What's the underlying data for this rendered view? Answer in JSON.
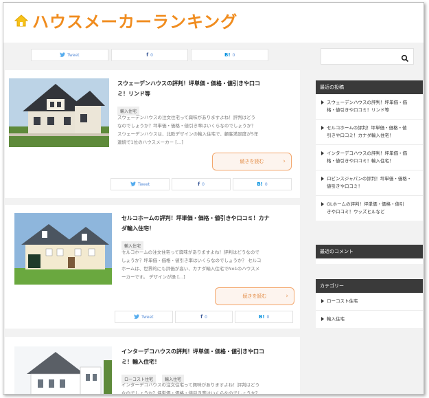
{
  "site": {
    "title": "ハウスメーカーランキング"
  },
  "share": {
    "tweet": "Tweet",
    "fb_count": "0",
    "hb_count": "0",
    "fb_icon": "f",
    "hb_icon": "B!"
  },
  "articles": [
    {
      "title_line1": "スウェーデンハウスの評判！坪単価・価格・値引きや口コ",
      "title_line2": "ミ！リンド等",
      "tags": [
        "輸入住宅"
      ],
      "excerpt": [
        "スウェーデンハウスの注文住宅って興味がありますよね！評判はどう",
        "なのでしょうか？坪単価・価格・値引き率はいくらなのでしょうか？",
        "スウェーデンハウスは、北欧デザインの輸入住宅で、顧客満足度が5年",
        "連続で1位のハウスメーカー […]"
      ],
      "more": "続きを読む"
    },
    {
      "title_line1": "セルコホームの評判！坪単価・価格・値引きや口コミ！カナ",
      "title_line2": "ダ輸入住宅！",
      "tags": [
        "輸入住宅"
      ],
      "excerpt": [
        "セルコホームの注文住宅って興味がありますよね！評判はどうなので",
        "しょうか？坪単価・価格・値引き率はいくらなのでしょうか？ セルコ",
        "ホームは、世界的にも評価が高い、カナダ輸入住宅でNo1のハウスメ",
        "ーカーです。 デザインが操 […]"
      ],
      "more": "続きを読む"
    },
    {
      "title_line1": "インターデコハウスの評判！坪単価・価格・値引きや口コ",
      "title_line2": "ミ！輸入住宅！",
      "tags": [
        "ローコスト住宅",
        "輸入住宅"
      ],
      "excerpt": [
        "インターデコハウスの注文住宅って興味がありますよね！評判はどう",
        "なのでしょうか？坪単価・価格・値引き率はいくらなのでしょうか？"
      ]
    }
  ],
  "sidebar": {
    "recent_posts": {
      "heading": "最近の投稿",
      "items": [
        [
          "スウェーデンハウスの評判！坪単価・価",
          "格・値引きや口コミ！リンド等"
        ],
        [
          "セルコホームの評判！坪単価・価格・値",
          "引きや口コミ！カナダ輸入住宅！"
        ],
        [
          "インターデコハウスの評判！坪単価・価",
          "格・値引きや口コミ！輸入住宅！"
        ],
        [
          "ロビンスジャパンの評判！坪単価・価格・",
          "値引きや口コミ！"
        ],
        [
          "GLホームの評判！坪単価・価格・値引",
          "きや口コミ！ウッズヒルなど"
        ]
      ]
    },
    "recent_comments": {
      "heading": "最近のコメント"
    },
    "categories": {
      "heading": "カテゴリー",
      "items": [
        "ローコスト住宅",
        "輸入住宅"
      ]
    }
  },
  "colors": {
    "accent": "#f08c1e",
    "twitter": "#55acee",
    "facebook": "#3b5998",
    "hatena": "#008fde"
  }
}
